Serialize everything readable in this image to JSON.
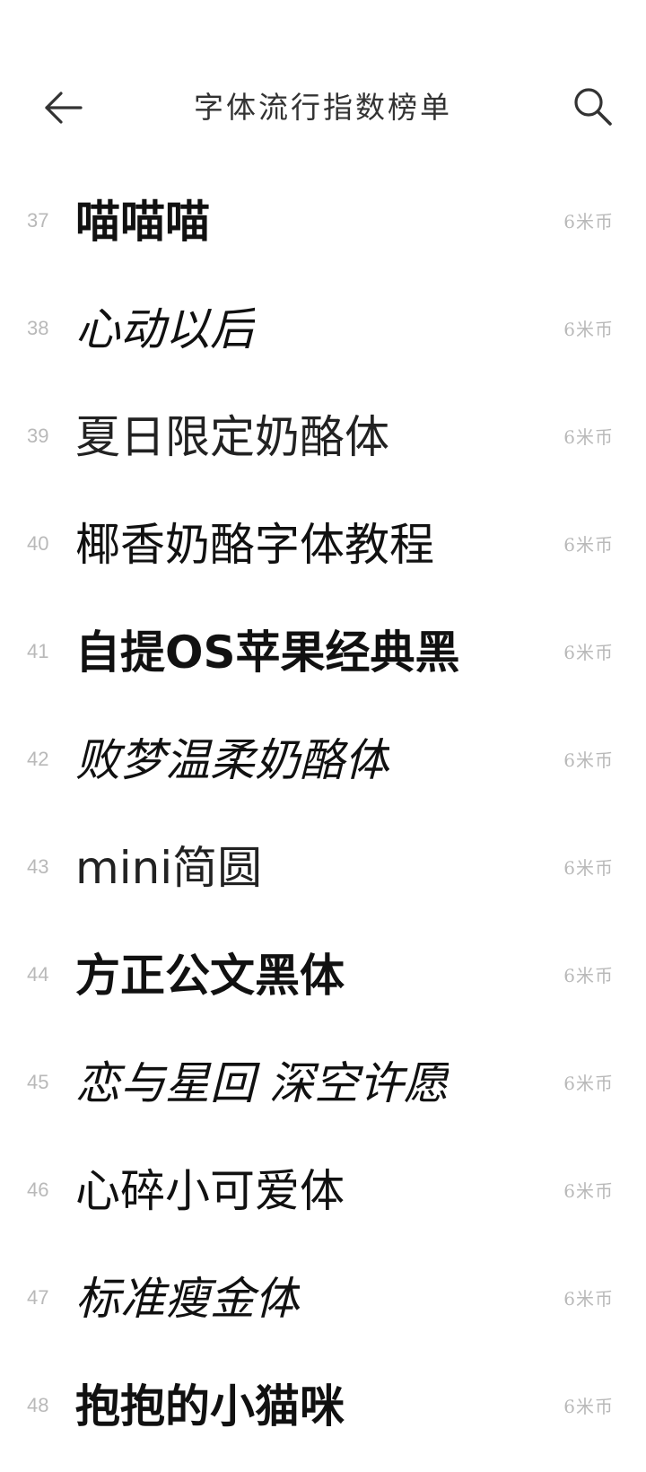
{
  "header": {
    "title": "字体流行指数榜单"
  },
  "fonts": [
    {
      "rank": "37",
      "name": "喵喵喵",
      "price": "6米币",
      "style": "bold"
    },
    {
      "rank": "38",
      "name": "心动以后",
      "price": "6米币",
      "style": "italic"
    },
    {
      "rank": "39",
      "name": "夏日限定奶酪体",
      "price": "6米币",
      "style": "light"
    },
    {
      "rank": "40",
      "name": "椰香奶酪字体教程",
      "price": "6米币",
      "style": "serif"
    },
    {
      "rank": "41",
      "name": "自提OS苹果经典黑",
      "price": "6米币",
      "style": "bold"
    },
    {
      "rank": "42",
      "name": "败梦温柔奶酪体",
      "price": "6米币",
      "style": "italic"
    },
    {
      "rank": "43",
      "name": "mini简圆",
      "price": "6米币",
      "style": "light"
    },
    {
      "rank": "44",
      "name": "方正公文黑体",
      "price": "6米币",
      "style": "bold"
    },
    {
      "rank": "45",
      "name": "恋与星回 深空许愿",
      "price": "6米币",
      "style": "italic"
    },
    {
      "rank": "46",
      "name": "心碎小可爱体",
      "price": "6米币",
      "style": "serif"
    },
    {
      "rank": "47",
      "name": "标准瘦金体",
      "price": "6米币",
      "style": "italic"
    },
    {
      "rank": "48",
      "name": "抱抱的小猫咪",
      "price": "6米币",
      "style": "bold"
    }
  ],
  "icons": {
    "back": "arrow-left-icon",
    "search": "search-icon"
  },
  "colors": {
    "text": "#111111",
    "muted": "#b9b9b9",
    "background": "#ffffff"
  }
}
